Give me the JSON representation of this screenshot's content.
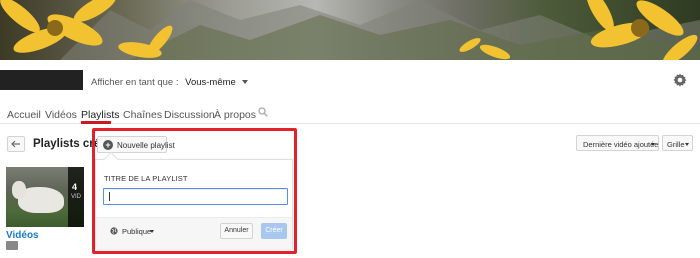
{
  "channel": {
    "view_as_label": "Afficher en tant que :",
    "view_as_value": "Vous-même"
  },
  "tabs": [
    {
      "label": "Accueil",
      "active": false
    },
    {
      "label": "Vidéos",
      "active": false
    },
    {
      "label": "Playlists",
      "active": true
    },
    {
      "label": "Chaînes",
      "active": false
    },
    {
      "label": "Discussion",
      "active": false
    },
    {
      "label": "À propos",
      "active": false
    }
  ],
  "toolbar": {
    "section_title": "Playlists créées",
    "new_playlist_label": "Nouvelle playlist",
    "sort_label": "Dernière vidéo ajoutée",
    "view_label": "Grille"
  },
  "playlist_tile": {
    "count": "4",
    "count_caption": "VID",
    "title": "Vidéos"
  },
  "popup": {
    "field_label": "TITRE DE LA PLAYLIST",
    "title_value": "",
    "privacy_label": "Publique",
    "cancel_label": "Annuler",
    "create_label": "Créer"
  },
  "icons": {
    "back": "back-arrow-icon",
    "plus": "plus-circle-icon",
    "gear": "gear-icon",
    "search": "search-icon",
    "globe": "globe-icon",
    "lock": "lock-icon"
  },
  "colors": {
    "accent_red": "#cc181e",
    "highlight_outline": "#e3232b",
    "link_blue": "#167ac6",
    "create_button": "#a8c7ee"
  }
}
